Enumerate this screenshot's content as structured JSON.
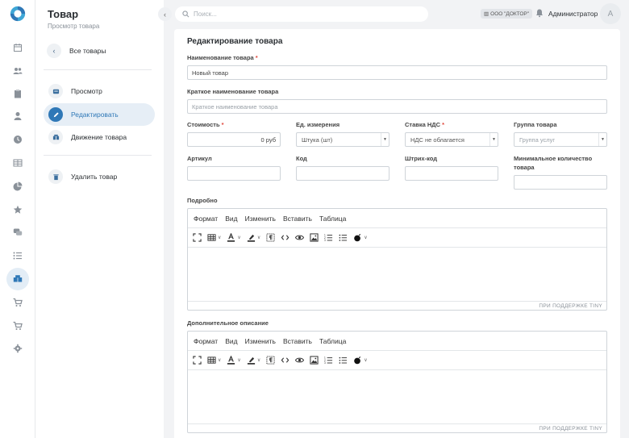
{
  "nav": {
    "rail_items": [
      {
        "icon": "calendar-icon"
      },
      {
        "icon": "users-icon"
      },
      {
        "icon": "clipboard-icon"
      },
      {
        "icon": "user-icon"
      },
      {
        "icon": "clock-icon"
      },
      {
        "icon": "table-icon"
      },
      {
        "icon": "pie-chart-icon"
      },
      {
        "icon": "star-icon"
      },
      {
        "icon": "chat-icon"
      },
      {
        "icon": "list-icon"
      },
      {
        "icon": "boxes-icon",
        "active": true
      },
      {
        "icon": "cart-icon"
      },
      {
        "icon": "cart-alt-icon"
      },
      {
        "icon": "gear-icon"
      }
    ]
  },
  "sidebar": {
    "title": "Товар",
    "subtitle": "Просмотр товара",
    "back_label": "Все товары",
    "items": [
      {
        "label": "Просмотр",
        "icon": "view-icon"
      },
      {
        "label": "Редактировать",
        "icon": "edit-icon",
        "active": true
      },
      {
        "label": "Движение товара",
        "icon": "movement-icon"
      }
    ],
    "delete_label": "Удалить товар"
  },
  "header": {
    "search_placeholder": "Поиск...",
    "org": "ООО \"ДОКТОР\"",
    "user": "Администратор",
    "avatar_initial": "А"
  },
  "form": {
    "title": "Редактирование товара",
    "name_label": "Наименование товара",
    "name_value": "Новый товар",
    "short_name_label": "Краткое наименование товара",
    "short_name_placeholder": "Краткое наименование товара",
    "price_label": "Стоимость",
    "price_value": "0 руб",
    "unit_label": "Ед. измерения",
    "unit_value": "Штука (шт)",
    "vat_label": "Ставка НДС",
    "vat_value": "НДС не облагается",
    "group_label": "Группа товара",
    "group_placeholder": "Группа услуг",
    "article_label": "Артикул",
    "code_label": "Код",
    "barcode_label": "Штрих-код",
    "min_qty_label": "Минимальное количество товара",
    "required_mark": "*"
  },
  "editors": {
    "details_label": "Подробно",
    "extra_label": "Дополнительное описание",
    "menu": [
      "Формат",
      "Вид",
      "Изменить",
      "Вставить",
      "Таблица"
    ],
    "status": "ПРИ ПОДДЕРЖКЕ TINY"
  },
  "colors": {
    "accent": "#2f78b7",
    "required": "#e0473c",
    "background": "#f2f3f5"
  }
}
